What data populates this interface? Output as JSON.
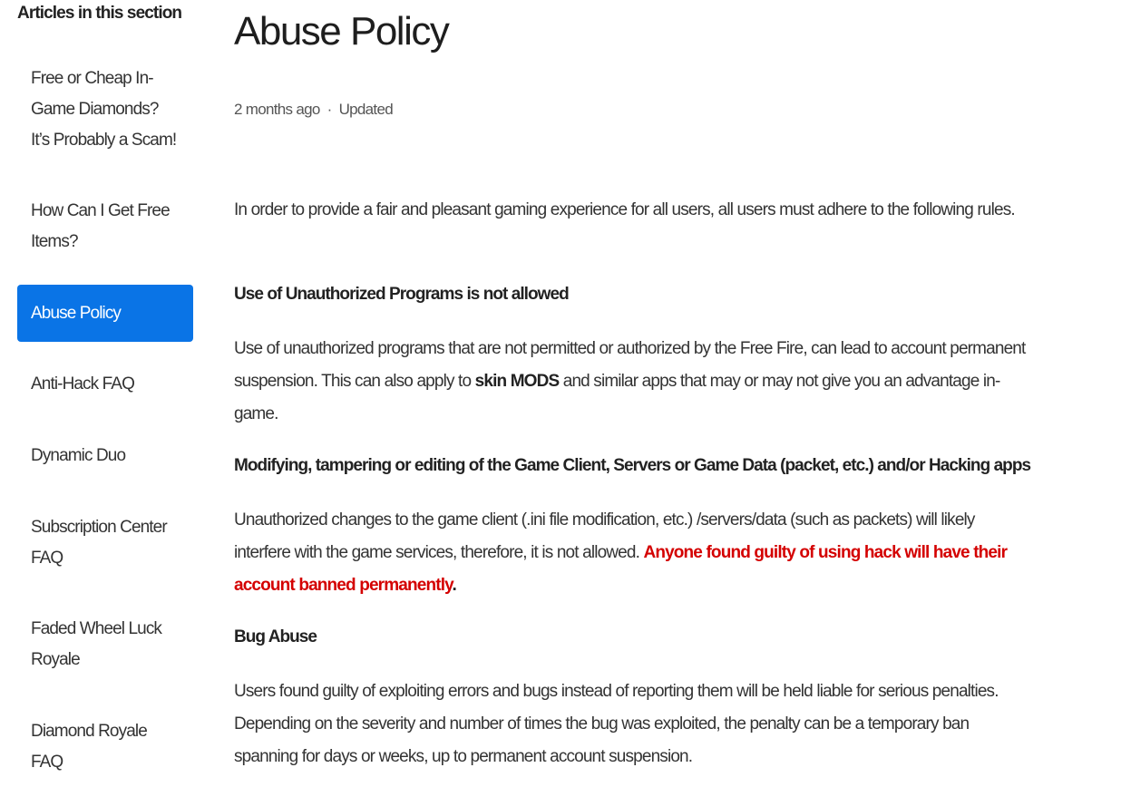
{
  "sidebar": {
    "title": "Articles in this section",
    "items": [
      {
        "label": "Free or Cheap In-Game Diamonds? It’s Probably a Scam!",
        "lines": [
          "Free or Cheap In-",
          "Game Diamonds?",
          "It’s Probably a Scam!"
        ],
        "active": false
      },
      {
        "label": "How Can I Get Free Items?",
        "lines": [
          "How Can I Get Free",
          "Items?"
        ],
        "active": false
      },
      {
        "label": "Abuse Policy",
        "lines": [
          "Abuse Policy"
        ],
        "active": true
      },
      {
        "label": "Anti-Hack FAQ",
        "lines": [
          "Anti-Hack FAQ"
        ],
        "active": false
      },
      {
        "label": "Dynamic Duo",
        "lines": [
          "Dynamic Duo"
        ],
        "active": false
      },
      {
        "label": "Subscription Center FAQ",
        "lines": [
          "Subscription Center",
          "FAQ"
        ],
        "active": false
      },
      {
        "label": "Faded Wheel Luck Royale",
        "lines": [
          "Faded Wheel Luck",
          "Royale"
        ],
        "active": false
      },
      {
        "label": "Diamond Royale FAQ",
        "lines": [
          "Diamond Royale",
          "FAQ"
        ],
        "active": false
      }
    ],
    "active_color": "#0a74e6"
  },
  "article": {
    "title": "Abuse Policy",
    "meta": {
      "time": "2 months ago",
      "separator": "·",
      "status": "Updated"
    },
    "intro": "In order to provide a fair and pleasant gaming experience for all users, all users must adhere to the following rules.",
    "sections": [
      {
        "heading": "Use of Unauthorized Programs is not allowed",
        "text_before": "Use of unauthorized programs that are not permitted or authorized by the Free Fire, can lead to account permanent suspension. This can also apply to ",
        "bold": "skin MODS",
        "text_after": " and similar apps that may or may not give you an advantage in-game."
      },
      {
        "heading": "Modifying, tampering or editing of the Game Client, Servers or Game Data (packet, etc.) and/or Hacking apps",
        "text_before": "Unauthorized changes to the game client (.ini file modification, etc.) /servers/data (such as packets) will likely interfere with the game services, therefore, it is not allowed. ",
        "warning": "Anyone found guilty of using hack will have their account banned permanently",
        "text_after": "."
      },
      {
        "heading": "Bug Abuse",
        "text": "Users found guilty of exploiting errors and bugs instead of reporting them will be held liable for serious penalties. Depending on the severity and number of times the bug was exploited, the penalty can be a temporary ban spanning for days or weeks, up to permanent account suspension."
      }
    ],
    "warning_color": "#d40000"
  }
}
